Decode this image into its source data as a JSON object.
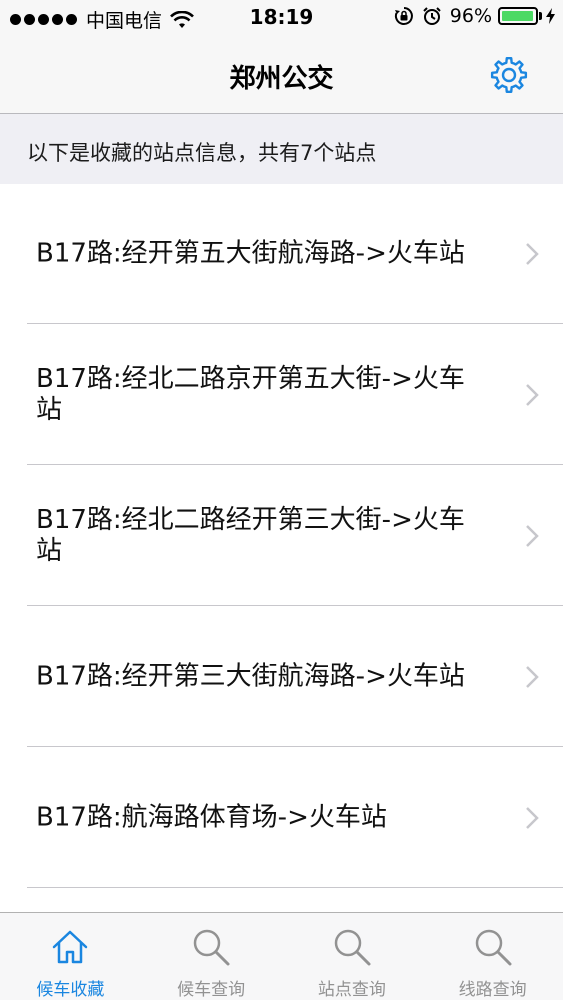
{
  "status_bar": {
    "carrier": "中国电信",
    "time": "18:19",
    "battery_percent": "96%",
    "battery_level": 0.96
  },
  "nav": {
    "title": "郑州公交",
    "settings_icon": "gear-icon"
  },
  "info": {
    "text": "以下是收藏的站点信息，共有7个站点"
  },
  "stations": [
    {
      "label": "B17路:经开第五大街航海路->火车站"
    },
    {
      "label": "B17路:经北二路京开第五大街->火车站"
    },
    {
      "label": "B17路:经北二路经开第三大街->火车站"
    },
    {
      "label": "B17路:经开第三大街航海路->火车站"
    },
    {
      "label": "B17路:航海路体育场->火车站"
    }
  ],
  "tabs": [
    {
      "label": "候车收藏",
      "icon": "home-icon",
      "active": true
    },
    {
      "label": "候车查询",
      "icon": "search-icon",
      "active": false
    },
    {
      "label": "站点查询",
      "icon": "search-icon",
      "active": false
    },
    {
      "label": "线路查询",
      "icon": "search-icon",
      "active": false
    }
  ],
  "colors": {
    "accent": "#1a86e0",
    "inactive": "#929292",
    "battery": "#4cd964"
  }
}
